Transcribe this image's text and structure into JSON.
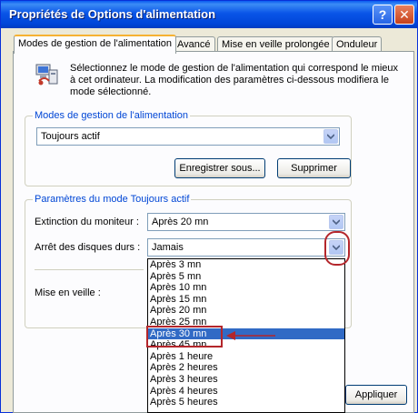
{
  "window": {
    "title": "Propriétés de Options d'alimentation",
    "help_label": "?",
    "close_label": "✕"
  },
  "tabs": [
    {
      "label": "Modes de gestion de l'alimentation",
      "active": true
    },
    {
      "label": "Avancé",
      "active": false
    },
    {
      "label": "Mise en veille prolongée",
      "active": false
    },
    {
      "label": "Onduleur",
      "active": false
    }
  ],
  "intro": {
    "icon": "power-schemes-icon",
    "text": "Sélectionnez le mode de gestion de l'alimentation qui correspond le mieux à cet ordinateur. La modification des paramètres ci-dessous modifiera le mode sélectionné."
  },
  "schemes_group": {
    "legend": "Modes de gestion de l'alimentation",
    "selected": "Toujours actif",
    "save_label": "Enregistrer sous...",
    "delete_label": "Supprimer"
  },
  "settings_group": {
    "legend": "Paramètres du mode Toujours actif",
    "monitor_label": "Extinction du moniteur :",
    "monitor_value": "Après 20 mn",
    "disks_label": "Arrêt des disques durs :",
    "disks_value": "Jamais",
    "standby_label": "Mise en veille :"
  },
  "dropdown": {
    "items": [
      "Après 3 mn",
      "Après 5 mn",
      "Après 10 mn",
      "Après 15 mn",
      "Après 20 mn",
      "Après 25 mn",
      "Après 30 mn",
      "Après 45 mn",
      "Après 1 heure",
      "Après 2 heures",
      "Après 3 heures",
      "Après 4 heures",
      "Après 5 heures"
    ],
    "selected_index": 6
  },
  "footer": {
    "apply_label": "Appliquer"
  },
  "colors": {
    "titlebar": "#0A55E8",
    "selection": "#316AC5",
    "annotation": "#B4262B",
    "legend": "#0046D5"
  }
}
